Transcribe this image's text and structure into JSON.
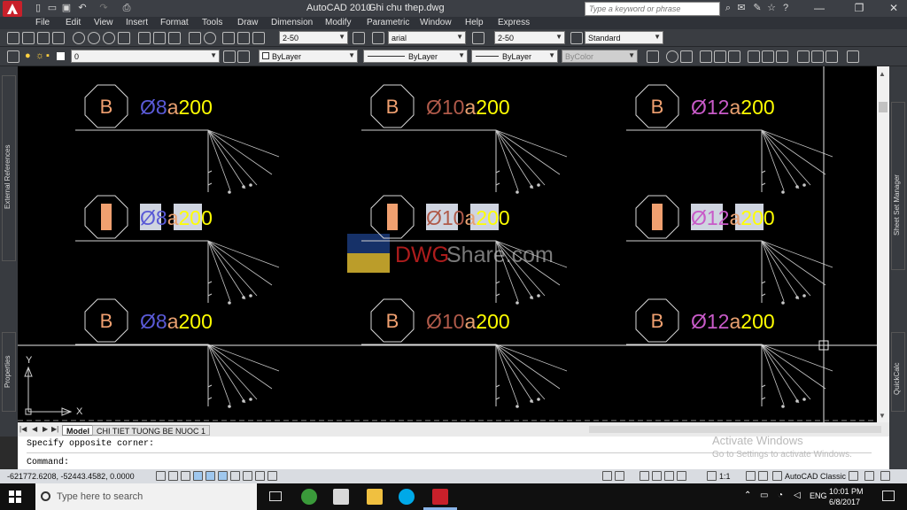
{
  "titlebar": {
    "app_name": "AutoCAD 2010",
    "file_name": "Ghi chu thep.dwg",
    "search_placeholder": "Type a keyword or phrase"
  },
  "menu": [
    "File",
    "Edit",
    "View",
    "Insert",
    "Format",
    "Tools",
    "Draw",
    "Dimension",
    "Modify",
    "Parametric",
    "Window",
    "Help",
    "Express"
  ],
  "toolbar1": {
    "dim_style": "2-50",
    "text_style": "arial",
    "dim_style2": "2-50",
    "table_style": "Standard"
  },
  "toolbar2": {
    "layer": "0",
    "color": "ByLayer",
    "linetype": "ByLayer",
    "lineweight": "ByLayer",
    "plotstyle": "ByColor"
  },
  "palettes": {
    "left_top": "External References",
    "left_bottom": "Properties",
    "right_top": "Sheet Set Manager",
    "right_bottom": "QuickCalc"
  },
  "drawing": {
    "rows": [
      {
        "style": "normal",
        "cells": [
          {
            "tag": "B",
            "dia": "Ø8",
            "a": "a",
            "spacing": "200"
          },
          {
            "tag": "B",
            "dia": "Ø10",
            "a": "a",
            "spacing": "200"
          },
          {
            "tag": "B",
            "dia": "Ø12",
            "a": "a",
            "spacing": "200"
          }
        ]
      },
      {
        "style": "selected",
        "cells": [
          {
            "tag": "",
            "dia": "Ø8",
            "a": "a",
            "spacing": "200"
          },
          {
            "tag": "",
            "dia": "Ø10",
            "a": "a",
            "spacing": "200"
          },
          {
            "tag": "",
            "dia": "Ø12",
            "a": "a",
            "spacing": "200"
          }
        ]
      },
      {
        "style": "normal",
        "cells": [
          {
            "tag": "B",
            "dia": "Ø8",
            "a": "a",
            "spacing": "200"
          },
          {
            "tag": "B",
            "dia": "Ø10",
            "a": "a",
            "spacing": "200"
          },
          {
            "tag": "B",
            "dia": "Ø12",
            "a": "a",
            "spacing": "200"
          }
        ]
      }
    ],
    "dia_colors": [
      "#5a5ad6",
      "#b05a4a",
      "#c85ac8"
    ],
    "a_color": "#e8a070",
    "spacing_color": "#ffff00",
    "tag_color": "#f0a070",
    "watermark_dwg": "DWG",
    "watermark_share": "Share.com",
    "ucs_x": "X",
    "ucs_y": "Y"
  },
  "tabs": [
    "Model",
    "CHI TIET TUONG BE NUOC 1"
  ],
  "command": {
    "history": "Specify opposite corner:",
    "prompt": "Command:"
  },
  "activate": {
    "title": "Activate Windows",
    "subtitle": "Go to Settings to activate Windows."
  },
  "statusbar": {
    "coords": "-621772.6208, -52443.4582, 0.0000",
    "scale": "1:1",
    "workspace": "AutoCAD Classic"
  },
  "taskbar": {
    "search": "Type here to search",
    "lang": "ENG",
    "time": "10:01 PM",
    "date": "6/8/2017"
  }
}
